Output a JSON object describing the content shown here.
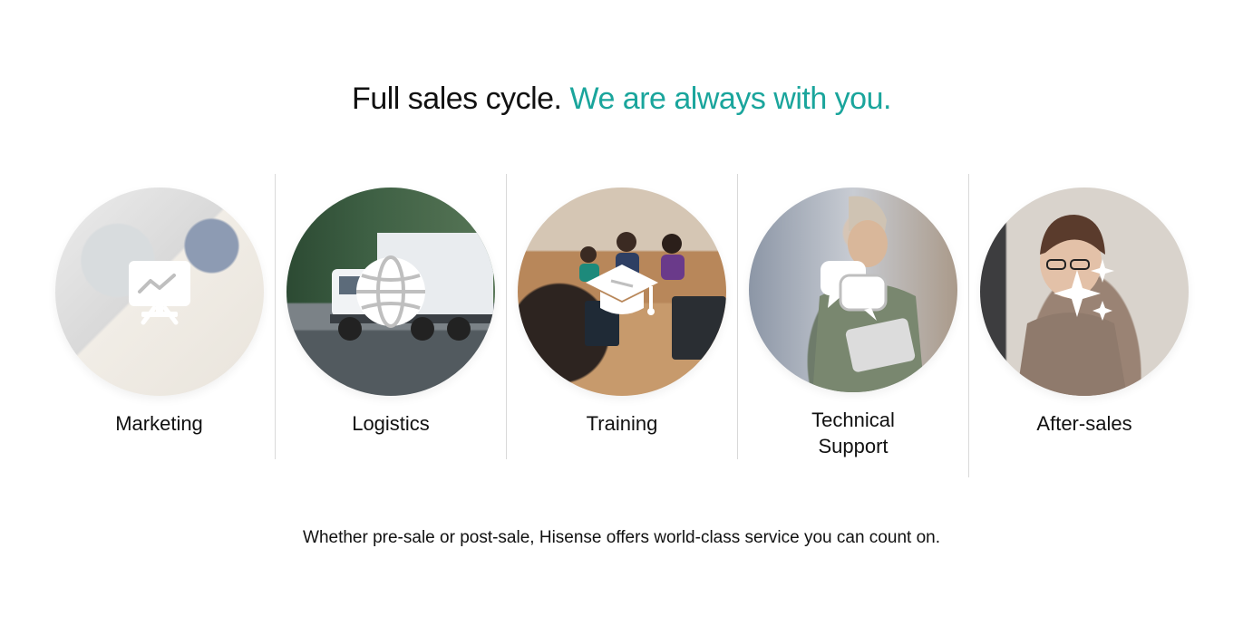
{
  "header": {
    "title_main": "Full sales cycle.",
    "title_accent": "We are always with you."
  },
  "accent_color": "#1aa59c",
  "services": [
    {
      "label": "Marketing",
      "icon": "presentation-chart-icon"
    },
    {
      "label": "Logistics",
      "icon": "globe-icon"
    },
    {
      "label": "Training",
      "icon": "graduation-cap-icon"
    },
    {
      "label_line1": "Technical",
      "label_line2": "Support",
      "icon": "chat-bubbles-icon"
    },
    {
      "label": "After-sales",
      "icon": "sparkles-icon"
    }
  ],
  "footer": {
    "text": "Whether pre-sale or post-sale, Hisense offers world-class service you can count on."
  }
}
